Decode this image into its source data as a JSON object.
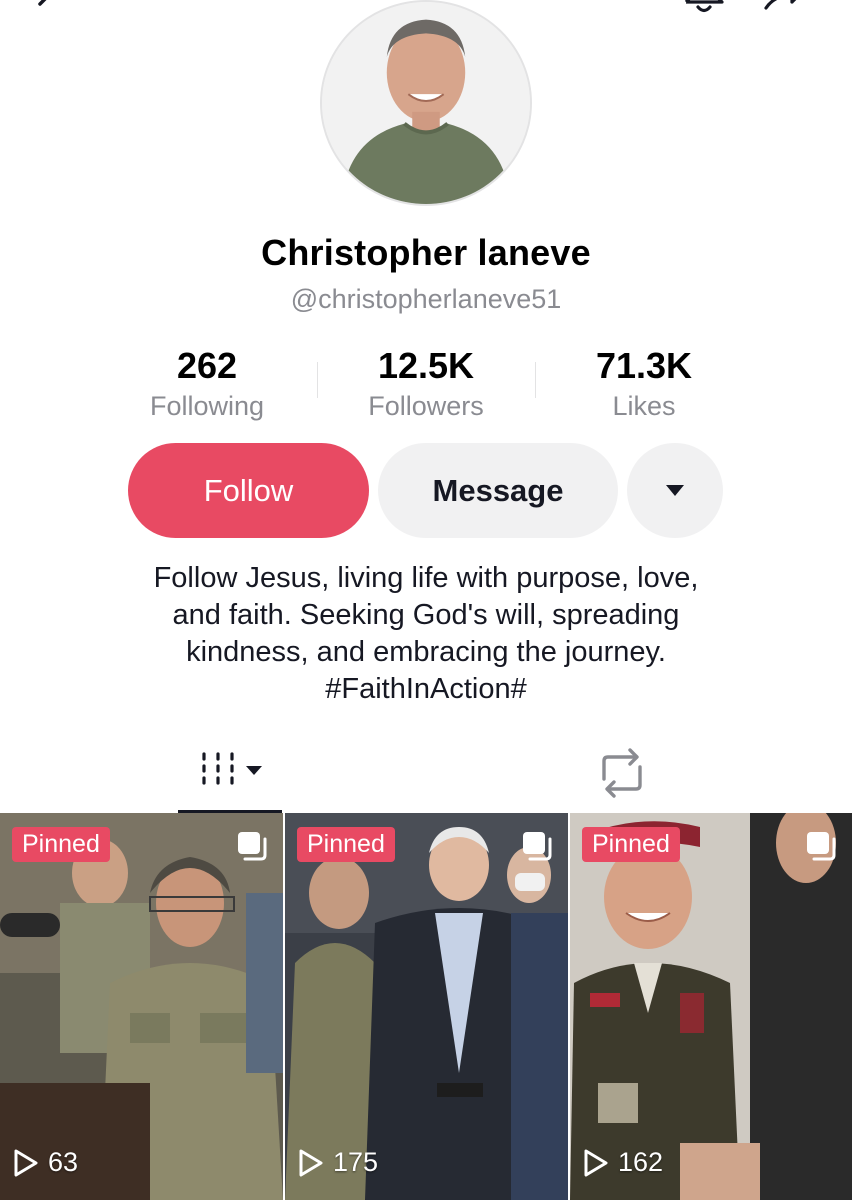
{
  "header": {
    "back_icon": "back-arrow-icon",
    "bell_icon": "bell-icon",
    "share_icon": "share-icon"
  },
  "profile": {
    "avatar_icon": "avatar",
    "display_name": "Christopher laneve",
    "handle": "@christopherlaneve51"
  },
  "stats": {
    "following": {
      "value": "262",
      "label": "Following"
    },
    "followers": {
      "value": "12.5K",
      "label": "Followers"
    },
    "likes": {
      "value": "71.3K",
      "label": "Likes"
    }
  },
  "actions": {
    "follow_label": "Follow",
    "message_label": "Message",
    "more_icon": "caret-down-icon"
  },
  "bio": {
    "lines": [
      "Follow Jesus, living life with purpose, love,",
      "and faith. Seeking God's will, spreading",
      "kindness, and embracing the journey.",
      "#FaithInAction#"
    ]
  },
  "tabs": [
    {
      "icon": "videos-grid-icon",
      "active": true
    },
    {
      "icon": "repost-icon",
      "active": false
    }
  ],
  "videos": [
    {
      "badge": "Pinned",
      "views": "63",
      "multi_icon": "multi-clip-icon"
    },
    {
      "badge": "Pinned",
      "views": "175",
      "multi_icon": "multi-clip-icon"
    },
    {
      "badge": "Pinned",
      "views": "162",
      "multi_icon": "multi-clip-icon"
    }
  ],
  "colors": {
    "accent": "#e84a63",
    "secondary_button": "#f1f1f2",
    "muted_text": "#8a8b91",
    "primary_text": "#161823"
  }
}
